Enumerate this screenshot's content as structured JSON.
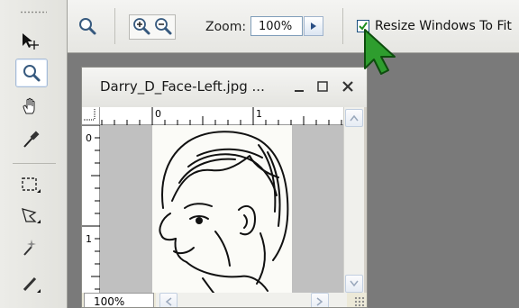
{
  "options_bar": {
    "zoom_label": "Zoom:",
    "zoom_value": "100%",
    "resize_checkbox": {
      "label": "Resize Windows To Fit",
      "checked": true
    }
  },
  "document": {
    "title": "Darry_D_Face-Left.jpg ...",
    "zoom_status": "100%",
    "ruler_h_labels": [
      "0",
      "1"
    ],
    "ruler_v_labels": [
      "0",
      "1"
    ]
  },
  "colors": {
    "checkbox_border": "#1c5180",
    "cursor": "#2e9d2e",
    "canvas_bg": "#c0c0c0",
    "workspace_bg": "#7a7a7a"
  },
  "icons": [
    "move-tool-icon",
    "zoom-tool-icon",
    "hand-tool-icon",
    "eyedropper-tool-icon",
    "marquee-tool-icon",
    "lasso-tool-icon",
    "magic-wand-tool-icon",
    "brush-tool-icon",
    "zoom-in-icon",
    "zoom-out-icon",
    "arrow-cursor-icon"
  ]
}
